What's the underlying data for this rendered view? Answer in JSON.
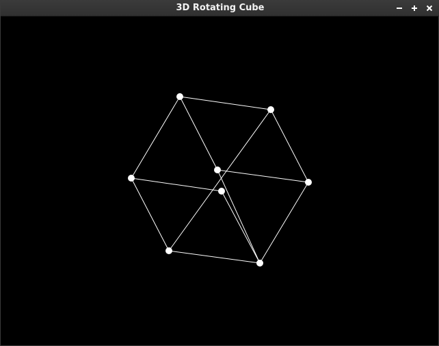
{
  "window": {
    "title": "3D Rotating Cube",
    "controls": [
      {
        "name": "minimize",
        "icon": "minimize-icon"
      },
      {
        "name": "maximize",
        "icon": "maximize-icon"
      },
      {
        "name": "close",
        "icon": "close-icon"
      }
    ]
  },
  "scene": {
    "background_color": "#000000",
    "line_color": "#ffffff",
    "vertex_color": "#ffffff",
    "object": "cube",
    "vertex_count": 8,
    "edge_count": 12
  }
}
